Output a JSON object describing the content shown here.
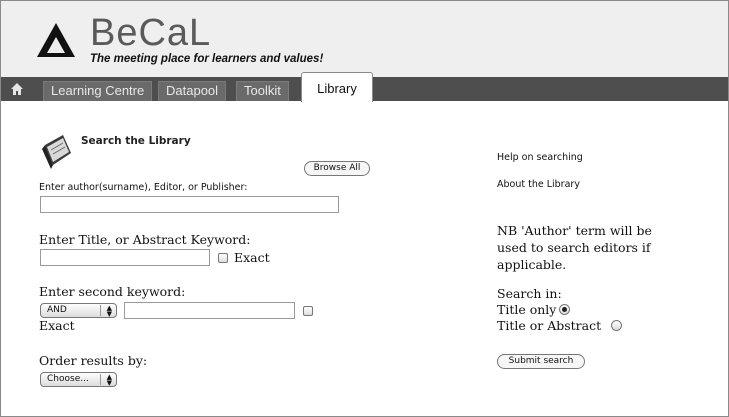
{
  "header": {
    "brand": "BeCaL",
    "tagline": "The meeting place for learners and values!"
  },
  "nav": {
    "home_icon": "home-icon",
    "items": [
      "Learning Centre",
      "Datapool",
      "Toolkit"
    ],
    "active": "Library"
  },
  "search": {
    "title": "Search the Library",
    "browse_all": "Browse All",
    "author_label": "Enter author(surname), Editor, or Publisher:",
    "author_value": "",
    "title_label": "Enter Title, or Abstract Keyword:",
    "title_value": "",
    "exact_label": "Exact",
    "second_label": "Enter second keyword:",
    "operator": "AND",
    "second_value": "",
    "exact2_label": "Exact",
    "order_label": "Order results by:",
    "order_value": "Choose..."
  },
  "side": {
    "help": "Help on searching",
    "about": "About the Library",
    "note": "NB 'Author' term will be used to search editors if applicable.",
    "search_in": "Search in:",
    "opt_title": "Title only",
    "opt_abstract": "Title or Abstract",
    "selected": "Title only",
    "submit": "Submit search"
  }
}
